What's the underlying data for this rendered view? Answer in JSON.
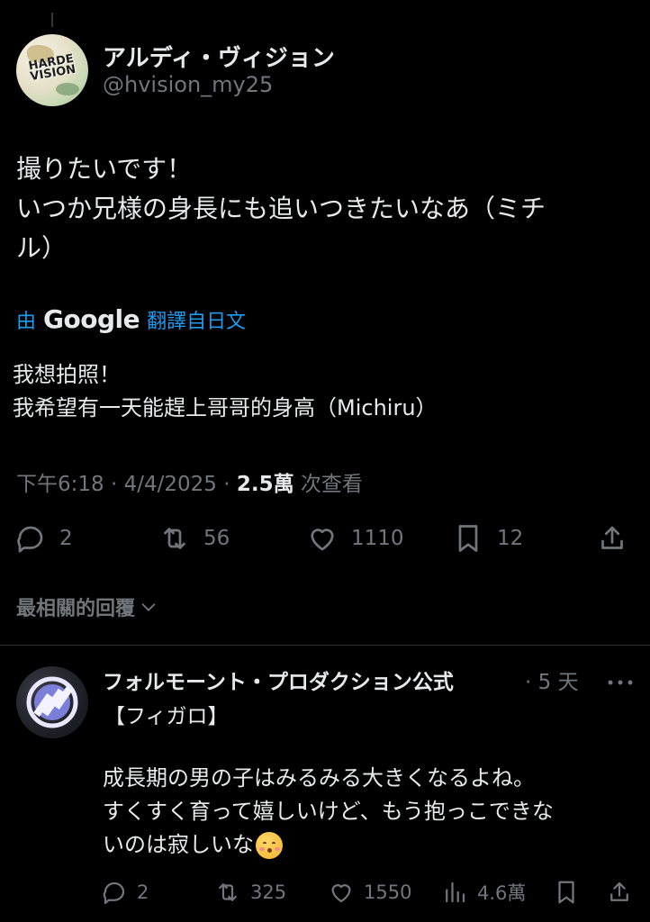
{
  "colors": {
    "background": "#000000",
    "text": "#e7e9ea",
    "secondary": "#71767b",
    "link": "#1d9bf0"
  },
  "post": {
    "author_name": "アルディ・ヴィジョン",
    "author_handle": "@hvision_my25",
    "avatar_text": "HARDE VISION",
    "text_lines": [
      "撮りたいです！",
      "いつか兄様の身長にも追いつきたいなあ（ミチ",
      "ル）"
    ],
    "translate": {
      "by": "由",
      "brand": "Google",
      "from": "翻譯自日文"
    },
    "translated_lines": [
      "我想拍照！",
      "我希望有一天能趕上哥哥的身高（Michiru）"
    ],
    "meta": {
      "time": "下午6:18 · 4/4/2025 · ",
      "views_count": "2.5萬",
      "views_label": " 次查看"
    },
    "actions": {
      "replies": "2",
      "reposts": "56",
      "likes": "1110",
      "bookmarks": "12"
    }
  },
  "sort_label": "最相關的回覆",
  "reply": {
    "author_name": "フォルモーント・プロダクション公式",
    "time": "· 5 天",
    "bracket_text": "【フィガロ】",
    "text_lines": [
      "成長期の男の子はみるみる大きくなるよね。",
      "すくすく育って嬉しいけど、もう抱っこできな",
      "いのは寂しいな"
    ],
    "emoji": "kissing-face-icon",
    "actions": {
      "replies": "2",
      "reposts": "325",
      "likes": "1550",
      "views": "4.6萬"
    }
  }
}
